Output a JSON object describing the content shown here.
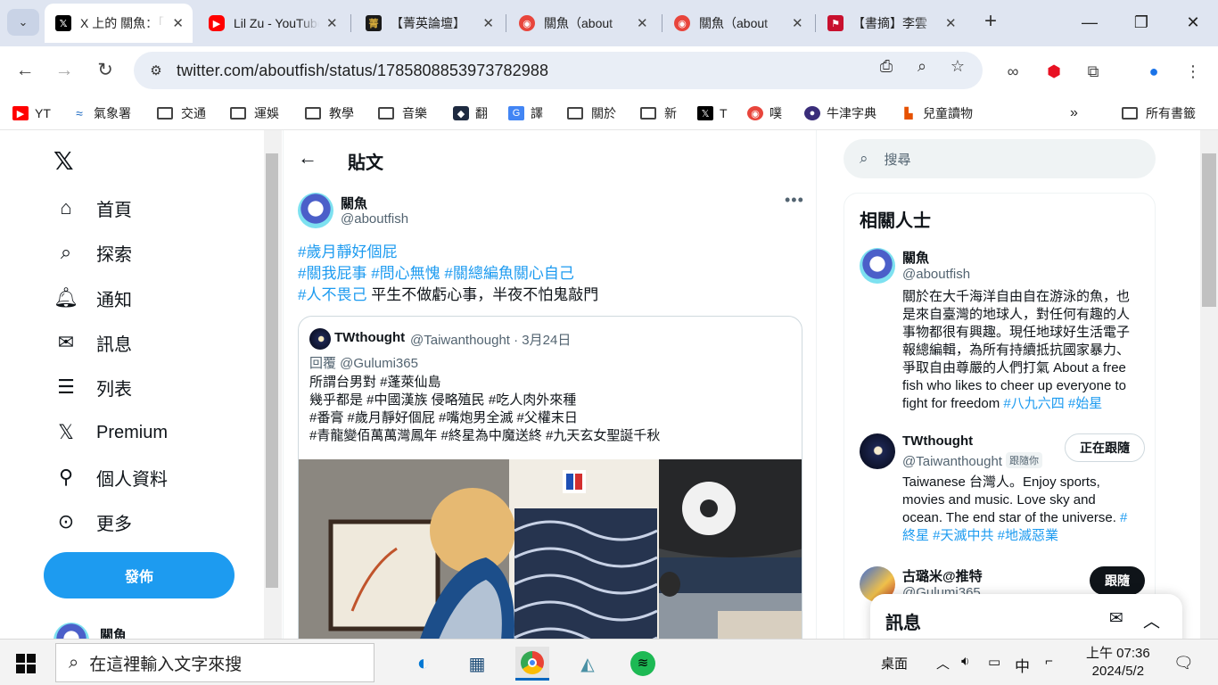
{
  "browser": {
    "tabs": [
      {
        "title": "X 上的 關魚：「",
        "icon": "x-logo-icon",
        "active": true
      },
      {
        "title": "Lil Zu - YouTube",
        "icon": "youtube-icon",
        "active": false
      },
      {
        "title": "【菁英論壇】",
        "icon": "forum-icon",
        "active": false
      },
      {
        "title": "關魚（about",
        "icon": "aboutfish-icon",
        "active": false
      },
      {
        "title": "關魚（about",
        "icon": "aboutfish-icon",
        "active": false
      },
      {
        "title": "【書摘】李雲",
        "icon": "flag-icon",
        "active": false
      }
    ],
    "url": "twitter.com/aboutfish/status/1785808853973782988",
    "bookmarks": [
      {
        "label": "YT",
        "icon": "youtube-icon"
      },
      {
        "label": "氣象署",
        "icon": "weather-icon"
      },
      {
        "label": "交通",
        "icon": "folder-icon"
      },
      {
        "label": "運娛",
        "icon": "folder-icon"
      },
      {
        "label": "教學",
        "icon": "folder-icon"
      },
      {
        "label": "音樂",
        "icon": "folder-icon"
      },
      {
        "label": "翻",
        "icon": "translate-icon"
      },
      {
        "label": "譯",
        "icon": "google-translate-icon"
      },
      {
        "label": "關於",
        "icon": "folder-icon"
      },
      {
        "label": "新",
        "icon": "folder-icon"
      },
      {
        "label": "T",
        "icon": "x-logo-icon"
      },
      {
        "label": "噗",
        "icon": "plurk-icon"
      },
      {
        "label": "牛津字典",
        "icon": "oxford-icon"
      },
      {
        "label": "兒童讀物",
        "icon": "books-icon"
      }
    ],
    "all_bookmarks": "所有書籤"
  },
  "sidebar": {
    "items": [
      {
        "label": "首頁",
        "icon": "home-icon"
      },
      {
        "label": "探索",
        "icon": "search-icon"
      },
      {
        "label": "通知",
        "icon": "bell-icon"
      },
      {
        "label": "訊息",
        "icon": "mail-icon"
      },
      {
        "label": "列表",
        "icon": "list-icon"
      },
      {
        "label": "Premium",
        "icon": "x-logo-icon"
      },
      {
        "label": "個人資料",
        "icon": "person-icon"
      },
      {
        "label": "更多",
        "icon": "more-circle-icon"
      }
    ],
    "post_button": "發佈",
    "profile_name": "關魚"
  },
  "main": {
    "title": "貼文",
    "author_name": "關魚",
    "author_handle": "@aboutfish",
    "tweet_lines": [
      [
        {
          "t": "#歲月靜好個屁",
          "tag": true
        }
      ],
      [
        {
          "t": "#關我屁事",
          "tag": true
        },
        {
          "t": " ",
          "tag": false
        },
        {
          "t": "#問心無愧",
          "tag": true
        },
        {
          "t": " ",
          "tag": false
        },
        {
          "t": "#關總編魚關心自己",
          "tag": true
        }
      ],
      [
        {
          "t": "#人不畏己",
          "tag": true
        },
        {
          "t": " 平生不做虧心事，半夜不怕鬼敲門",
          "tag": false
        }
      ]
    ],
    "quote": {
      "name": "TWthought",
      "handle": "@Taiwanthought",
      "date": "· 3月24日",
      "reply_to": "回覆 @Gulumi365",
      "lines": [
        "所謂台男對 #蓬萊仙島",
        "幾乎都是 #中國漢族 侵略殖民 #吃人肉外來種",
        "#番膏 #歲月靜好個屁 #嘴炮男全滅 #父權末日",
        "#青龍變佰萬萬灣鳳年 #終星為中魔送終 #九天玄女聖誕千秋"
      ]
    }
  },
  "right": {
    "search_placeholder": "搜尋",
    "related_title": "相關人士",
    "people": [
      {
        "name": "關魚",
        "handle": "@aboutfish",
        "badge": "",
        "bio": "關於在大千海洋自由自在游泳的魚，也是來自臺灣的地球人，對任何有趣的人事物都很有興趣。現任地球好生活電子報總編輯，為所有持續抵抗國家暴力、爭取自由尊嚴的人們打氣 About a free fish who likes to cheer up everyone to fight for freedom ",
        "bio_tags": "#八九六四 #始星",
        "button": ""
      },
      {
        "name": "TWthought",
        "handle": "@Taiwanthought",
        "badge": "跟隨你",
        "bio": "Taiwanese 台灣人。Enjoy sports, movies and music. Love sky and ocean. The end star of the universe. ",
        "bio_tags": "#終星 #天滅中共 #地滅惡業",
        "button": "正在跟隨"
      },
      {
        "name": "古璐米@推特",
        "handle": "@Gulumi365",
        "badge": "",
        "bio": "",
        "bio_tags": "",
        "button": "跟隨"
      }
    ],
    "messages_title": "訊息"
  },
  "taskbar": {
    "search_placeholder": "在這裡輸入文字來搜",
    "desktop": "桌面",
    "ime": "中",
    "time": "上午 07:36",
    "date": "2024/5/2"
  }
}
